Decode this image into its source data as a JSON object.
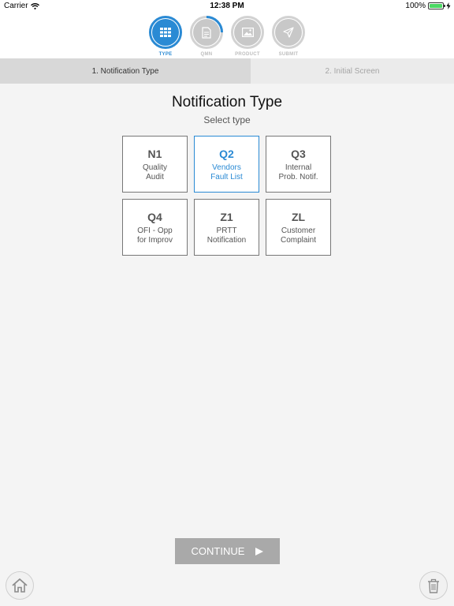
{
  "status_bar": {
    "carrier": "Carrier",
    "time": "12:38 PM",
    "battery": "100%"
  },
  "steps": [
    {
      "label": "TYPE",
      "icon": "grid-icon",
      "state": "active"
    },
    {
      "label": "QMN",
      "icon": "document-icon",
      "state": "partial"
    },
    {
      "label": "PRODUCT",
      "icon": "image-icon",
      "state": "inactive"
    },
    {
      "label": "SUBMIT",
      "icon": "send-icon",
      "state": "inactive"
    }
  ],
  "tabs": [
    {
      "label": "1. Notification Type",
      "active": true
    },
    {
      "label": "2. Initial Screen",
      "active": false
    }
  ],
  "main": {
    "title": "Notification Type",
    "subtitle": "Select type"
  },
  "types": [
    {
      "code": "N1",
      "line1": "Quality",
      "line2": "Audit",
      "selected": false
    },
    {
      "code": "Q2",
      "line1": "Vendors",
      "line2": "Fault List",
      "selected": true
    },
    {
      "code": "Q3",
      "line1": "Internal",
      "line2": "Prob. Notif.",
      "selected": false
    },
    {
      "code": "Q4",
      "line1": "OFI - Opp",
      "line2": "for Improv",
      "selected": false
    },
    {
      "code": "Z1",
      "line1": "PRTT",
      "line2": "Notification",
      "selected": false
    },
    {
      "code": "ZL",
      "line1": "Customer",
      "line2": "Complaint",
      "selected": false
    }
  ],
  "footer": {
    "continue_label": "CONTINUE",
    "home_icon": "home-icon",
    "trash_icon": "trash-icon"
  },
  "colors": {
    "accent": "#2a8ad4",
    "inactive_step": "#c8c8c8",
    "continue_bg": "#a9a9a9",
    "battery_green": "#4cd964"
  }
}
